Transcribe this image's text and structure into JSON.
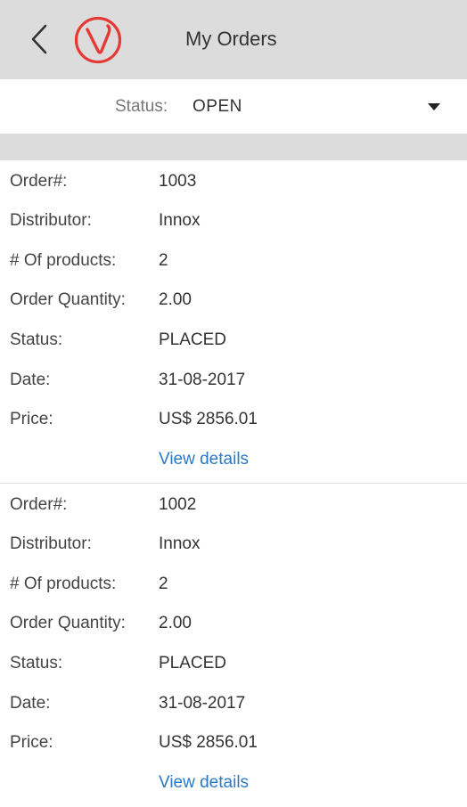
{
  "header": {
    "title": "My Orders",
    "back_icon": "chevron-left-icon",
    "logo_icon": "v-logo-icon",
    "logo_color": "#e53935",
    "background": "#dcdcdc"
  },
  "filter": {
    "label": "Status:",
    "value": "OPEN",
    "arrow_icon": "caret-down-icon"
  },
  "orders": [
    {
      "fields": [
        {
          "label": "Order#:",
          "value": "1003"
        },
        {
          "label": "Distributor:",
          "value": "Innox"
        },
        {
          "label": "# Of products:",
          "value": "2"
        },
        {
          "label": "Order Quantity:",
          "value": "2.00"
        },
        {
          "label": "Status:",
          "value": "PLACED"
        },
        {
          "label": "Date:",
          "value": "31-08-2017"
        },
        {
          "label": "Price:",
          "value": "US$ 2856.01"
        }
      ],
      "link_label": "View details"
    },
    {
      "fields": [
        {
          "label": "Order#:",
          "value": "1002"
        },
        {
          "label": "Distributor:",
          "value": "Innox"
        },
        {
          "label": "# Of products:",
          "value": "2"
        },
        {
          "label": "Order Quantity:",
          "value": "2.00"
        },
        {
          "label": "Status:",
          "value": "PLACED"
        },
        {
          "label": "Date:",
          "value": "31-08-2017"
        },
        {
          "label": "Price:",
          "value": "US$ 2856.01"
        }
      ],
      "link_label": "View details"
    }
  ],
  "colors": {
    "link": "#2979c4",
    "separator": "#dcdcdc"
  }
}
